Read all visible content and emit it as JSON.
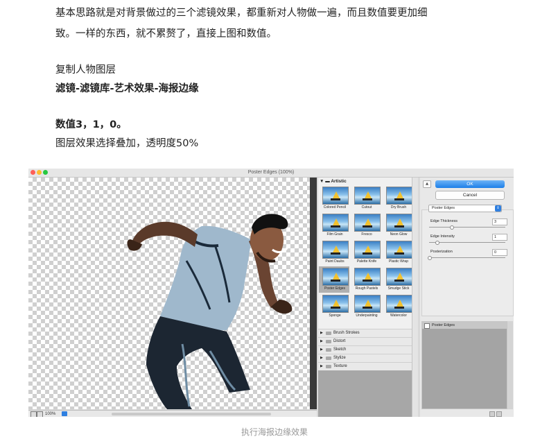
{
  "article": {
    "line1": "基本思路就是对背景做过的三个滤镜效果，都重新对人物做一遍，而且数值要更加细",
    "line2": "致。一样的东西，就不累赘了，直接上图和数值。",
    "line3": "复制人物图层",
    "line4": "滤镜-滤镜库-艺术效果-海报边缘",
    "line5": "数值3，1，0。",
    "line6": "图层效果选择叠加，透明度50%"
  },
  "dialog": {
    "title": "Poster Edges (100%)",
    "zoom": "100%",
    "gallery": {
      "folder": "Artistic",
      "filters": [
        "Colored Pencil",
        "Cutout",
        "Dry Brush",
        "Film Grain",
        "Fresco",
        "Neon Glow",
        "Paint Daubs",
        "Palette Knife",
        "Plastic Wrap",
        "Poster Edges",
        "Rough Pastels",
        "Smudge Stick",
        "Sponge",
        "Underpainting",
        "Watercolor"
      ],
      "selected": "Poster Edges",
      "categories": [
        "Brush Strokes",
        "Distort",
        "Sketch",
        "Stylize",
        "Texture"
      ]
    },
    "ok_label": "OK",
    "cancel_label": "Cancel",
    "filter_select": "Poster Edges",
    "params": [
      {
        "label": "Edge Thickness",
        "value": "3",
        "max": 10
      },
      {
        "label": "Edge Intensity",
        "value": "1",
        "max": 10
      },
      {
        "label": "Posterization",
        "value": "0",
        "max": 6
      }
    ],
    "layer_name": "Poster Edges",
    "colors": {
      "ok_top": "#6db3f7",
      "ok_bottom": "#1d7fe8",
      "traffic_red": "#fe5f57",
      "traffic_yellow": "#febc2e",
      "traffic_green": "#28c840"
    }
  },
  "caption": "执行海报边缘效果"
}
